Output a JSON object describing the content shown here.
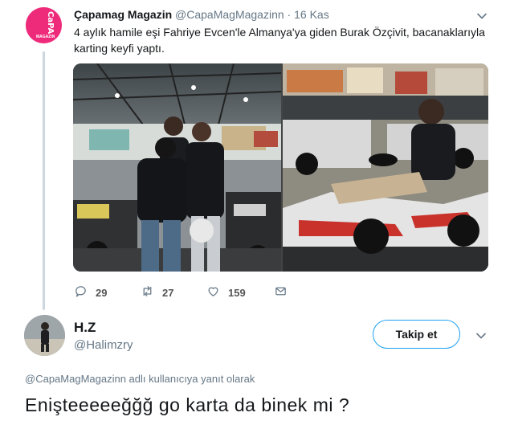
{
  "tweet": {
    "avatar_logo": "CaPA",
    "avatar_logo_small": "MAGAZIN",
    "author_name": "Çapamag Magazin",
    "author_handle": "@CapaMagMagazinn",
    "separator": "·",
    "date": "16 Kas",
    "text": "4 aylık hamile eşi Fahriye Evcen'le Almanya'ya giden Burak Özçivit, bacanaklarıyla karting keyfi yaptı.",
    "actions": {
      "reply_count": "29",
      "retweet_count": "27",
      "like_count": "159"
    }
  },
  "reply": {
    "author_name": "H.Z",
    "author_handle": "@Halimzry",
    "follow_label": "Takip et",
    "replying_to_handle": "@CapaMagMagazinn",
    "replying_to_suffix": " adlı kullanıcıya yanıt olarak",
    "text": "Enişteeeeeğğğ go karta da binek mi ?"
  },
  "colors": {
    "accent": "#1da1f2",
    "secondary_text": "#657786",
    "avatar_brand": "#ee2a7b"
  },
  "icons": [
    "chevron-down-icon",
    "reply-icon",
    "retweet-icon",
    "heart-icon",
    "dm-icon"
  ]
}
